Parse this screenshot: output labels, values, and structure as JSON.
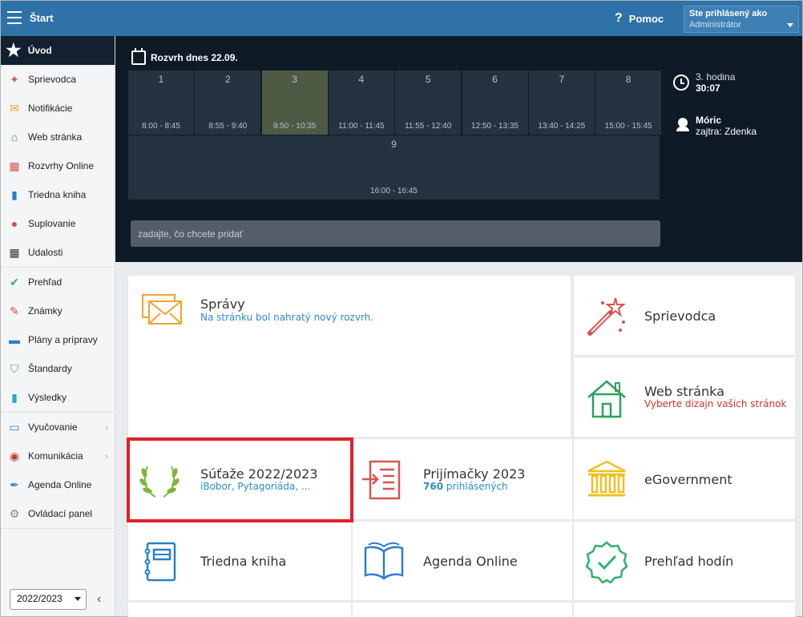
{
  "topbar": {
    "title": "Štart",
    "help_label": "Pomoc",
    "help_icon": "?",
    "login_label": "Ste prihlásený ako",
    "login_user": "Administrátor"
  },
  "sidebar": {
    "home_label": "Úvod",
    "groups": [
      [
        {
          "label": "Sprievodca",
          "icon": "wand-icon",
          "color": "#d9534f"
        },
        {
          "label": "Notifikácie",
          "icon": "envelope-icon",
          "color": "#f0a430"
        },
        {
          "label": "Web stránka",
          "icon": "house-icon",
          "color": "#2aa35a"
        },
        {
          "label": "Rozvrhy Online",
          "icon": "grid-icon",
          "color": "#d9534f"
        },
        {
          "label": "Triedna kniha",
          "icon": "book-icon",
          "color": "#2a7fc9"
        },
        {
          "label": "Suplovanie",
          "icon": "person-icon",
          "color": "#e04b3a"
        },
        {
          "label": "Udalosti",
          "icon": "calendar-icon",
          "color": "#333333"
        }
      ],
      [
        {
          "label": "Prehľad",
          "icon": "check-circle-icon",
          "color": "#2fb36a"
        },
        {
          "label": "Známky",
          "icon": "grade-icon",
          "color": "#e04b3a"
        },
        {
          "label": "Plány a prípravy",
          "icon": "briefcase-icon",
          "color": "#2a7fc9"
        },
        {
          "label": "Štandardy",
          "icon": "shield-icon",
          "color": "#2fb36a"
        },
        {
          "label": "Výsledky",
          "icon": "bar-chart-icon",
          "color": "#2a9fd8"
        }
      ],
      [
        {
          "label": "Vyučovanie",
          "icon": "open-book-icon",
          "color": "#2a7fc9",
          "chevron": "›"
        },
        {
          "label": "Komunikácia",
          "icon": "chat-icon",
          "color": "#c9382c",
          "chevron": "›"
        },
        {
          "label": "Agenda Online",
          "icon": "feather-icon",
          "color": "#2a7fc9"
        },
        {
          "label": "Ovládací panel",
          "icon": "gear-icon",
          "color": "#888888"
        }
      ]
    ],
    "year": "2022/2023",
    "collapse_icon": "‹"
  },
  "schedule": {
    "title": "Rozvrh dnes 22.09.",
    "lessons": [
      {
        "num": "1",
        "time": "8:00 - 8:45"
      },
      {
        "num": "2",
        "time": "8:55 - 9:40"
      },
      {
        "num": "3",
        "time": "9:50 - 10:35",
        "current": true
      },
      {
        "num": "4",
        "time": "11:00 - 11:45"
      },
      {
        "num": "5",
        "time": "11:55 - 12:40"
      },
      {
        "num": "6",
        "time": "12:50 - 13:35"
      },
      {
        "num": "7",
        "time": "13:40 - 14:25"
      },
      {
        "num": "8",
        "time": "15:00 - 15:45"
      },
      {
        "num": "9",
        "time": "16:00 - 16:45"
      }
    ],
    "add_placeholder": "zadajte, čo chcete pridať",
    "current_period": "3. hodina",
    "remaining": "30:07",
    "duty_name": "Móric",
    "duty_tomorrow": "zajtra: Zdenka"
  },
  "tiles": {
    "spravy": {
      "title": "Správy",
      "subtitle": "Na stránku bol nahratý nový rozvrh."
    },
    "sprievodca": {
      "title": "Sprievodca"
    },
    "web": {
      "title": "Web stránka",
      "subtitle": "Vyberte dizajn vašich stránok"
    },
    "sutaze": {
      "title": "Súťaže 2022/2023",
      "subtitle": "iBobor, Pytagoriáda, ..."
    },
    "prijimacky": {
      "title": "Prijímačky 2023",
      "subtitle_count": "760",
      "subtitle_rest": " prihlásených"
    },
    "egov": {
      "title": "eGovernment"
    },
    "triedna": {
      "title": "Triedna kniha"
    },
    "agenda": {
      "title": "Agenda Online"
    },
    "prehlad": {
      "title": "Prehľad hodín"
    }
  },
  "colors": {
    "topbar": "#2e72a8",
    "dark_panel": "#0f1a27",
    "link_blue": "#2a8cd0",
    "accent_red": "#d0312d",
    "highlight": "#e0202a"
  }
}
